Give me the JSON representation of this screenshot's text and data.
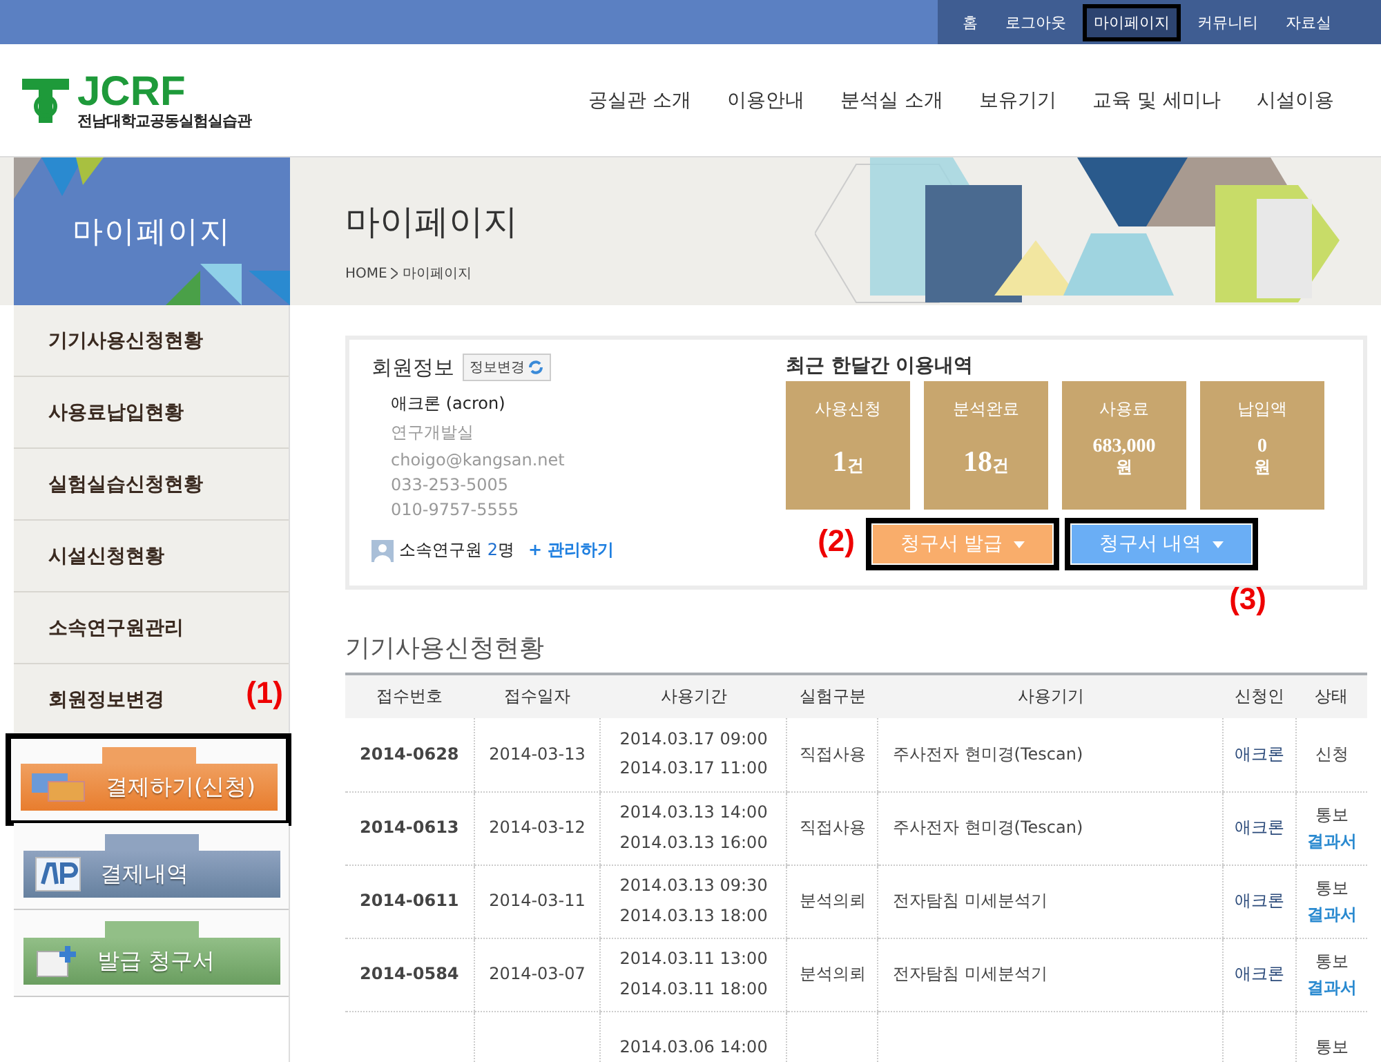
{
  "top_links": [
    {
      "label": "홈",
      "selected": false
    },
    {
      "label": "로그아웃",
      "selected": false
    },
    {
      "label": "마이페이지",
      "selected": true
    },
    {
      "label": "커뮤니티",
      "selected": false
    },
    {
      "label": "자료실",
      "selected": false
    }
  ],
  "logo": {
    "mark": "JCRF",
    "name": "전남대학교공동실험실습관"
  },
  "nav": [
    "공실관 소개",
    "이용안내",
    "분석실 소개",
    "보유기기",
    "교육 및 세미나",
    "시설이용"
  ],
  "banner": {
    "side_title": "마이페이지",
    "title": "마이페이지",
    "breadcrumb": [
      "HOME",
      "마이페이지"
    ]
  },
  "sidebar": {
    "items": [
      "기기사용신청현황",
      "사용료납입현황",
      "실험실습신청현황",
      "시설신청현황",
      "소속연구원관리",
      "회원정보변경"
    ],
    "action_buttons": [
      {
        "label": "결제하기(신청)",
        "kind": "orange",
        "highlighted": true,
        "annotation": "(1)"
      },
      {
        "label": "결제내역",
        "kind": "blue",
        "highlighted": false
      },
      {
        "label": "발급 청구서",
        "kind": "green",
        "highlighted": false
      }
    ]
  },
  "member": {
    "heading": "회원정보",
    "edit_button": "정보변경",
    "name": "애크론 (acron)",
    "department": "연구개발실",
    "email": "choigo@kangsan.net",
    "phone": "033-253-5005",
    "mobile": "010-9757-5555",
    "researchers_label": "소속연구원",
    "researchers_count": "2",
    "researchers_unit": "명",
    "manage_link": "+ 관리하기"
  },
  "usage": {
    "title": "최근 한달간 이용내역",
    "tiles": [
      {
        "label": "사용신청",
        "value": "1",
        "unit": "건",
        "kind": "count"
      },
      {
        "label": "분석완료",
        "value": "18",
        "unit": "건",
        "kind": "count"
      },
      {
        "label": "사용료",
        "value": "683,000",
        "unit": "원",
        "kind": "amount"
      },
      {
        "label": "납입액",
        "value": "0",
        "unit": "원",
        "kind": "amount"
      }
    ]
  },
  "invoice_buttons": [
    {
      "label": "청구서 발급",
      "kind": "orange",
      "highlighted": true,
      "annotation": "(2)"
    },
    {
      "label": "청구서 내역",
      "kind": "blue",
      "highlighted": true,
      "annotation": "(3)"
    }
  ],
  "table": {
    "title": "기기사용신청현황",
    "columns": [
      "접수번호",
      "접수일자",
      "사용기간",
      "실험구분",
      "사용기기",
      "신청인",
      "상태"
    ],
    "rows": [
      {
        "no": "2014-0628",
        "date": "2014-03-13",
        "period_start": "2014.03.17 09:00",
        "period_end": "2014.03.17 11:00",
        "type": "직접사용",
        "device": "주사전자 현미경(Tescan)",
        "applicant": "애크론",
        "status": "신청"
      },
      {
        "no": "2014-0613",
        "date": "2014-03-12",
        "period_start": "2014.03.13 14:00",
        "period_end": "2014.03.13 16:00",
        "type": "직접사용",
        "device": "주사전자 현미경(Tescan)",
        "applicant": "애크론",
        "status": "통보",
        "result_link": "결과서"
      },
      {
        "no": "2014-0611",
        "date": "2014-03-11",
        "period_start": "2014.03.13 09:30",
        "period_end": "2014.03.13 18:00",
        "type": "분석의뢰",
        "device": "전자탐침 미세분석기",
        "applicant": "애크론",
        "status": "통보",
        "result_link": "결과서"
      },
      {
        "no": "2014-0584",
        "date": "2014-03-07",
        "period_start": "2014.03.11 13:00",
        "period_end": "2014.03.11 18:00",
        "type": "분석의뢰",
        "device": "전자탐침 미세분석기",
        "applicant": "애크론",
        "status": "통보",
        "result_link": "결과서"
      },
      {
        "period_start": "2014.03.06 14:00",
        "status": "통보"
      }
    ]
  }
}
